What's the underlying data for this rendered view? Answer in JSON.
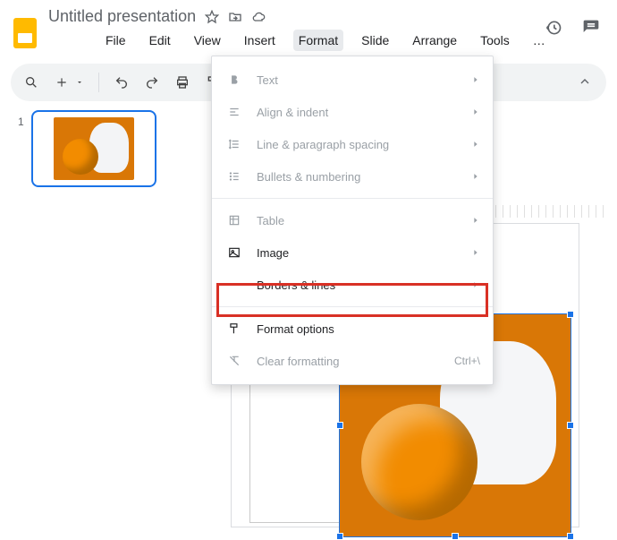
{
  "app": {
    "title": "Untitled presentation"
  },
  "menubar": [
    "File",
    "Edit",
    "View",
    "Insert",
    "Format",
    "Slide",
    "Arrange",
    "Tools",
    "…"
  ],
  "menubar_active_index": 4,
  "toolbar": {
    "icons": [
      "search",
      "add",
      "undo",
      "redo",
      "print",
      "paint-format"
    ]
  },
  "slide_panel": {
    "thumbs": [
      {
        "number": "1"
      }
    ]
  },
  "dropdown": {
    "items": [
      {
        "icon": "bold",
        "label": "Text",
        "submenu": true,
        "enabled": false
      },
      {
        "icon": "align",
        "label": "Align & indent",
        "submenu": true,
        "enabled": false
      },
      {
        "icon": "line-spacing",
        "label": "Line & paragraph spacing",
        "submenu": true,
        "enabled": false
      },
      {
        "icon": "bullets",
        "label": "Bullets & numbering",
        "submenu": true,
        "enabled": false
      },
      {
        "sep": true
      },
      {
        "icon": "table",
        "label": "Table",
        "submenu": true,
        "enabled": false
      },
      {
        "icon": "image",
        "label": "Image",
        "submenu": true,
        "enabled": true
      },
      {
        "icon": "borders",
        "label": "Borders & lines",
        "submenu": true,
        "enabled": true
      },
      {
        "sep": true
      },
      {
        "icon": "format-options",
        "label": "Format options",
        "submenu": false,
        "enabled": true,
        "highlight": true
      },
      {
        "icon": "clear",
        "label": "Clear formatting",
        "submenu": false,
        "enabled": false,
        "shortcut": "Ctrl+\\"
      }
    ]
  }
}
